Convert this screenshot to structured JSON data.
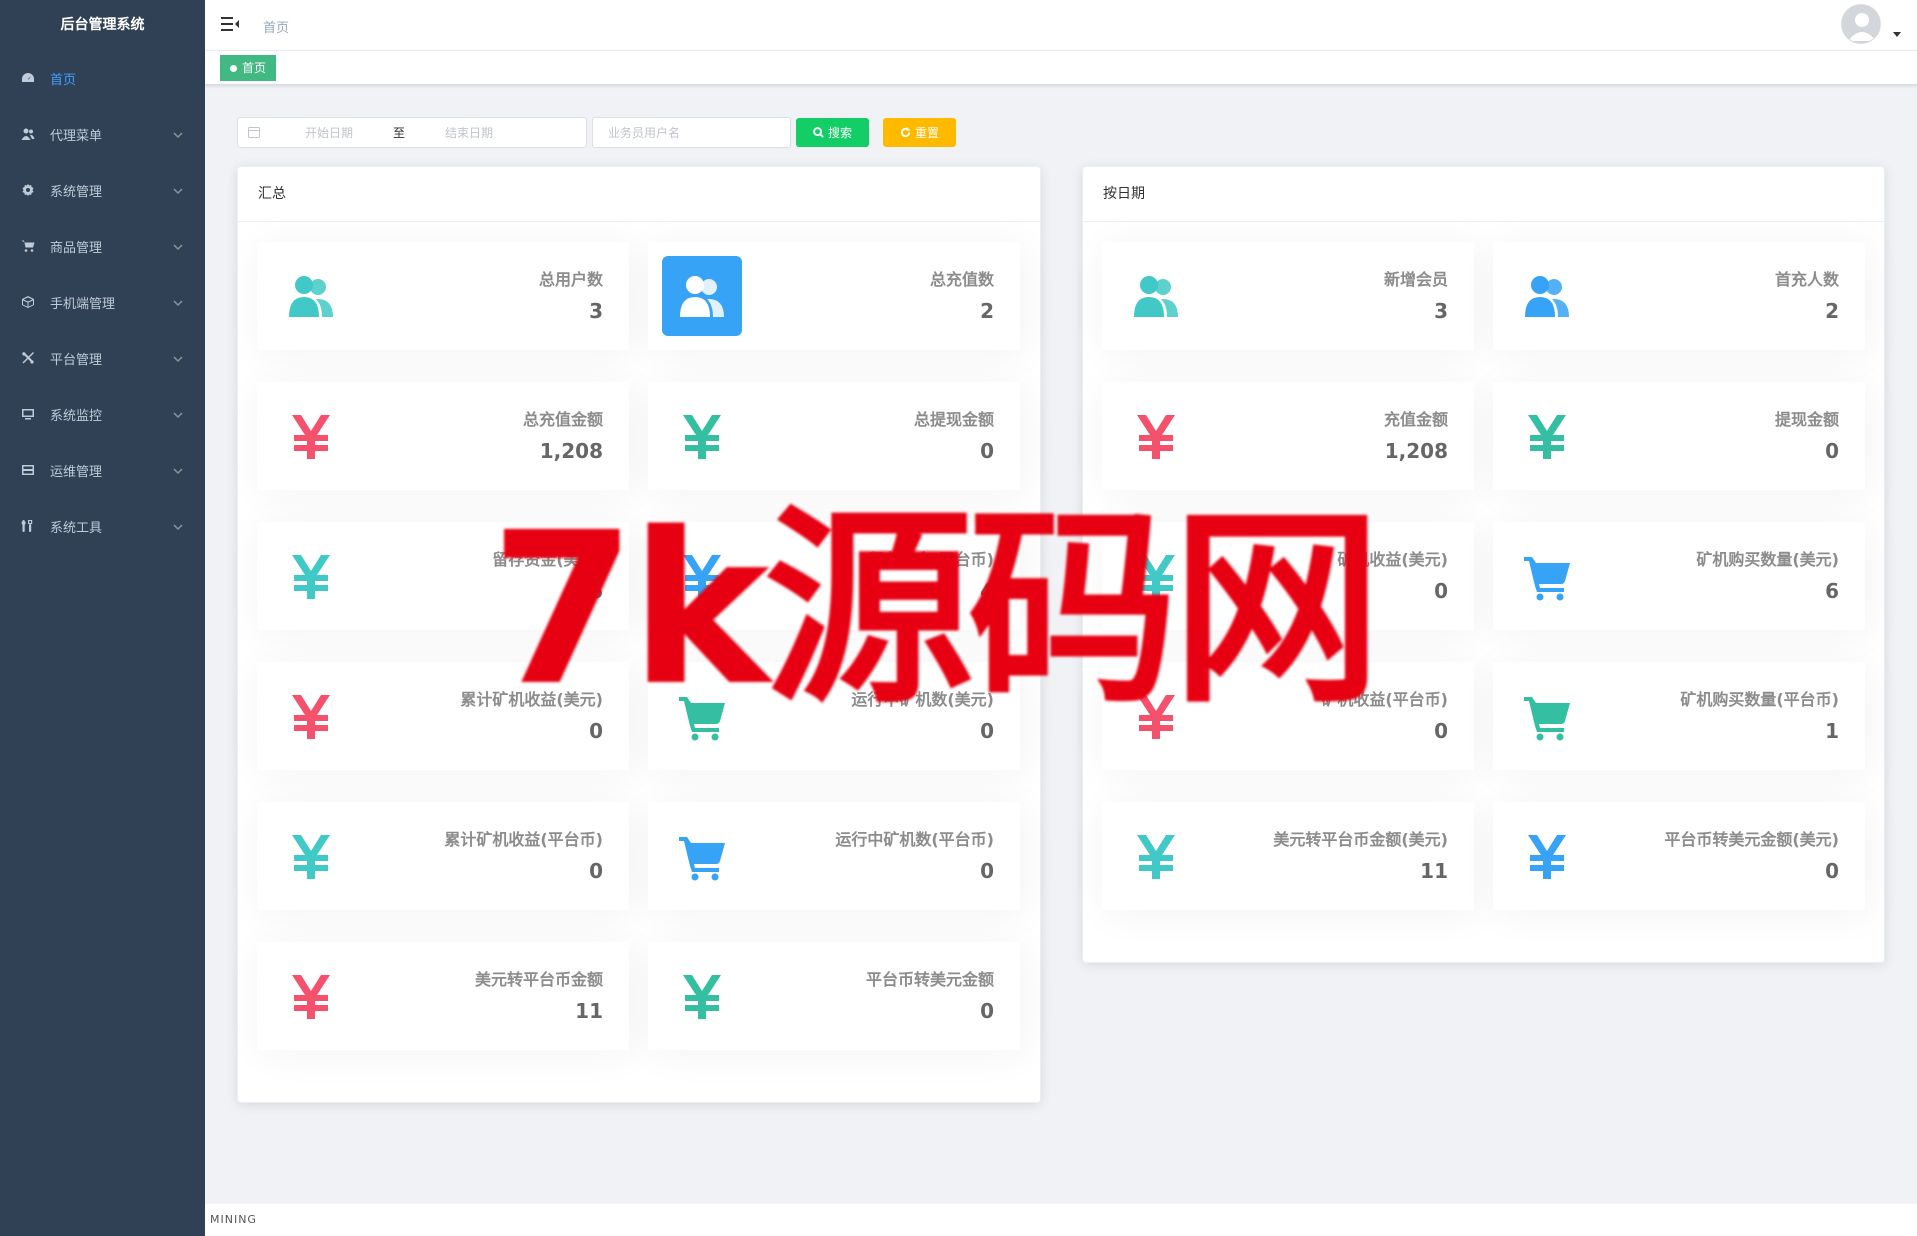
{
  "sidebar": {
    "title": "后台管理系统",
    "items": [
      {
        "label": "首页",
        "icon": "dashboard-icon",
        "active": true
      },
      {
        "label": "代理菜单",
        "icon": "users-icon"
      },
      {
        "label": "系统管理",
        "icon": "gear-icon"
      },
      {
        "label": "商品管理",
        "icon": "cart-icon"
      },
      {
        "label": "手机端管理",
        "icon": "cube-icon"
      },
      {
        "label": "平台管理",
        "icon": "tools-icon"
      },
      {
        "label": "系统监控",
        "icon": "monitor-icon"
      },
      {
        "label": "运维管理",
        "icon": "server-icon"
      },
      {
        "label": "系统工具",
        "icon": "wrench-icon"
      }
    ]
  },
  "navbar": {
    "breadcrumb": "首页"
  },
  "tags": {
    "active": "首页"
  },
  "filters": {
    "start_placeholder": "开始日期",
    "range_separator": "至",
    "end_placeholder": "结束日期",
    "user_placeholder": "业务员用户名",
    "search_label": "搜索",
    "reset_label": "重置"
  },
  "summary": {
    "title": "汇总",
    "cards": [
      {
        "label": "总用户数",
        "value": "3",
        "icon": "people-icon",
        "color": "#40c9c6"
      },
      {
        "label": "总充值数",
        "value": "2",
        "icon": "people-icon",
        "color": "#ffffff",
        "filled": true
      },
      {
        "label": "总充值金额",
        "value": "1,208",
        "icon": "yen-icon",
        "color": "#f4516c"
      },
      {
        "label": "总提现金额",
        "value": "0",
        "icon": "yen-icon",
        "color": "#34bfa3"
      },
      {
        "label": "留存资金(美元)",
        "value": "76",
        "icon": "yen-icon",
        "color": "#40c9c6"
      },
      {
        "label": "留存资金(平台币)",
        "value": "4",
        "icon": "yen-icon",
        "color": "#36a3f7"
      },
      {
        "label": "累计矿机收益(美元)",
        "value": "0",
        "icon": "yen-icon",
        "color": "#f4516c"
      },
      {
        "label": "运行中矿机数(美元)",
        "value": "0",
        "icon": "cart-icon",
        "color": "#34bfa3"
      },
      {
        "label": "累计矿机收益(平台币)",
        "value": "0",
        "icon": "yen-icon",
        "color": "#40c9c6"
      },
      {
        "label": "运行中矿机数(平台币)",
        "value": "0",
        "icon": "cart-icon",
        "color": "#36a3f7"
      },
      {
        "label": "美元转平台币金额",
        "value": "11",
        "icon": "yen-icon",
        "color": "#f4516c"
      },
      {
        "label": "平台币转美元金额",
        "value": "0",
        "icon": "yen-icon",
        "color": "#34bfa3"
      }
    ]
  },
  "by_date": {
    "title": "按日期",
    "cards": [
      {
        "label": "新增会员",
        "value": "3",
        "icon": "people-icon",
        "color": "#40c9c6"
      },
      {
        "label": "首充人数",
        "value": "2",
        "icon": "people-icon",
        "color": "#36a3f7"
      },
      {
        "label": "充值金额",
        "value": "1,208",
        "icon": "yen-icon",
        "color": "#f4516c"
      },
      {
        "label": "提现金额",
        "value": "0",
        "icon": "yen-icon",
        "color": "#34bfa3"
      },
      {
        "label": "矿机收益(美元)",
        "value": "0",
        "icon": "yen-icon",
        "color": "#40c9c6"
      },
      {
        "label": "矿机购买数量(美元)",
        "value": "6",
        "icon": "cart-icon",
        "color": "#36a3f7"
      },
      {
        "label": "矿机收益(平台币)",
        "value": "0",
        "icon": "yen-icon",
        "color": "#f4516c"
      },
      {
        "label": "矿机购买数量(平台币)",
        "value": "1",
        "icon": "cart-icon",
        "color": "#34bfa3"
      },
      {
        "label": "美元转平台币金额(美元)",
        "value": "11",
        "icon": "yen-icon",
        "color": "#40c9c6"
      },
      {
        "label": "平台币转美元金额(美元)",
        "value": "0",
        "icon": "yen-icon",
        "color": "#36a3f7"
      }
    ]
  },
  "footer": {
    "text": "MINING"
  },
  "watermark": {
    "text": "7k源码网",
    "color": "#e60012"
  }
}
